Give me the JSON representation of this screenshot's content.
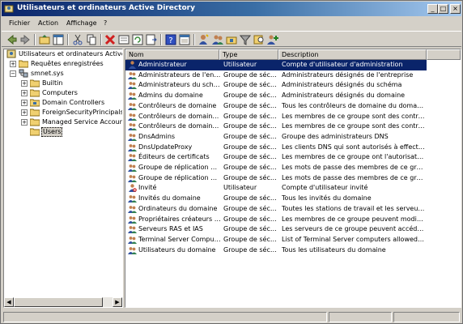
{
  "window": {
    "title": "Utilisateurs et ordinateurs Active Directory"
  },
  "menu": [
    "Fichier",
    "Action",
    "Affichage",
    "?"
  ],
  "toolbar": [
    "back-icon",
    "forward-icon",
    "up-icon",
    "show-hide-tree-icon",
    "cut-icon",
    "copy-icon",
    "delete-icon",
    "properties-icon",
    "refresh-icon",
    "export-list-icon",
    "help-icon",
    "console-help-icon",
    "new-user-icon",
    "new-group-icon",
    "new-ou-icon",
    "filter-icon",
    "find-icon",
    "add-to-group-icon"
  ],
  "tree": {
    "root": "Utilisateurs et ordinateurs Active Di",
    "saved_queries": "Requêtes enregistrées",
    "domain": "smnet.sys",
    "children": [
      "Builtin",
      "Computers",
      "Domain Controllers",
      "ForeignSecurityPrincipals",
      "Managed Service Accounts",
      "Users"
    ]
  },
  "columns": {
    "name": "Nom",
    "type": "Type",
    "description": "Description"
  },
  "rows": [
    {
      "icon": "user-icon",
      "name": "Administrateur",
      "type": "Utilisateur",
      "description": "Compte d'utilisateur d'administration"
    },
    {
      "icon": "group-icon",
      "name": "Administrateurs de l'entrep...",
      "type": "Groupe de sécu...",
      "description": "Administrateurs désignés de l'entreprise"
    },
    {
      "icon": "group-icon",
      "name": "Administrateurs du schéma",
      "type": "Groupe de sécu...",
      "description": "Administrateurs désignés du schéma"
    },
    {
      "icon": "group-icon",
      "name": "Admins du domaine",
      "type": "Groupe de sécu...",
      "description": "Administrateurs désignés du domaine"
    },
    {
      "icon": "group-icon",
      "name": "Contrôleurs de domaine",
      "type": "Groupe de sécu...",
      "description": "Tous les contrôleurs de domaine du domaine"
    },
    {
      "icon": "group-icon",
      "name": "Contrôleurs de domaine ...",
      "type": "Groupe de sécu...",
      "description": "Les membres de ce groupe sont des contrôle..."
    },
    {
      "icon": "group-icon",
      "name": "Contrôleurs de domaine ...",
      "type": "Groupe de sécu...",
      "description": "Les membres de ce groupe sont des contrôle..."
    },
    {
      "icon": "group-icon",
      "name": "DnsAdmins",
      "type": "Groupe de sécu...",
      "description": "Groupe des administrateurs DNS"
    },
    {
      "icon": "group-icon",
      "name": "DnsUpdateProxy",
      "type": "Groupe de sécu...",
      "description": "Les clients DNS qui sont autorisés à effectuer..."
    },
    {
      "icon": "group-icon",
      "name": "Éditeurs de certificats",
      "type": "Groupe de sécu...",
      "description": "Les membres de ce groupe ont l'autorisation ..."
    },
    {
      "icon": "group-icon",
      "name": "Groupe de réplication do...",
      "type": "Groupe de sécu...",
      "description": "Les mots de passe des membres de ce groupe ..."
    },
    {
      "icon": "group-icon",
      "name": "Groupe de réplication do...",
      "type": "Groupe de sécu...",
      "description": "Les mots de passe des membres de ce groupe ..."
    },
    {
      "icon": "user-disabled-icon",
      "name": "Invité",
      "type": "Utilisateur",
      "description": "Compte d'utilisateur invité"
    },
    {
      "icon": "group-icon",
      "name": "Invités du domaine",
      "type": "Groupe de sécu...",
      "description": "Tous les invités du domaine"
    },
    {
      "icon": "group-icon",
      "name": "Ordinateurs du domaine",
      "type": "Groupe de sécu...",
      "description": "Toutes les stations de travail et les serveurs j..."
    },
    {
      "icon": "group-icon",
      "name": "Propriétaires créateurs d...",
      "type": "Groupe de sécu...",
      "description": "Les membres de ce groupe peuvent modifier l..."
    },
    {
      "icon": "group-icon",
      "name": "Serveurs RAS et IAS",
      "type": "Groupe de sécu...",
      "description": "Les serveurs de ce groupe peuvent accéder ..."
    },
    {
      "icon": "group-icon",
      "name": "Terminal Server Computers",
      "type": "Groupe de sécu...",
      "description": "List of Terminal Server computers allowed to ..."
    },
    {
      "icon": "group-icon",
      "name": "Utilisateurs du domaine",
      "type": "Groupe de sécu...",
      "description": "Tous les utilisateurs du domaine"
    }
  ],
  "colors": {
    "selection": "#0a246a",
    "title_start": "#0a246a",
    "title_end": "#a6caf0",
    "folder": "#f0d070"
  }
}
